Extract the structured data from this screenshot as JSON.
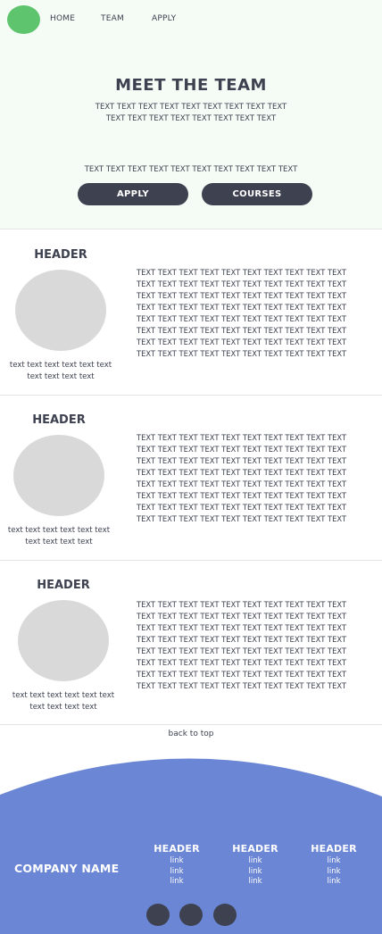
{
  "nav": {
    "home": "HOME",
    "team": "TEAM",
    "apply": "APPLY"
  },
  "hero": {
    "title": "MEET THE TEAM",
    "text": "TEXT TEXT TEXT TEXT TEXT TEXT TEXT TEXT TEXT TEXT TEXT TEXT TEXT TEXT TEXT TEXT TEXT",
    "subtext": "TEXT TEXT TEXT TEXT TEXT TEXT TEXT TEXT TEXT TEXT",
    "apply_button": "APPLY",
    "courses_button": "COURSES"
  },
  "members": [
    {
      "header": "HEADER",
      "caption": "text text text text text text text text text text",
      "body": "TEXT TEXT TEXT TEXT TEXT TEXT TEXT TEXT TEXT TEXT TEXT TEXT TEXT TEXT TEXT TEXT TEXT TEXT TEXT TEXT TEXT TEXT TEXT TEXT TEXT TEXT TEXT TEXT TEXT TEXT TEXT TEXT TEXT TEXT TEXT TEXT TEXT TEXT TEXT TEXT TEXT TEXT TEXT TEXT TEXT TEXT TEXT TEXT TEXT TEXT TEXT TEXT TEXT TEXT TEXT TEXT TEXT TEXT TEXT TEXT TEXT TEXT TEXT TEXT TEXT TEXT TEXT TEXT TEXT TEXT TEXT TEXT TEXT TEXT TEXT TEXT TEXT TEXT TEXT TEXT"
    },
    {
      "header": "HEADER",
      "caption": "text text text text text text text text text text",
      "body": "TEXT TEXT TEXT TEXT TEXT TEXT TEXT TEXT TEXT TEXT TEXT TEXT TEXT TEXT TEXT TEXT TEXT TEXT TEXT TEXT TEXT TEXT TEXT TEXT TEXT TEXT TEXT TEXT TEXT TEXT TEXT TEXT TEXT TEXT TEXT TEXT TEXT TEXT TEXT TEXT TEXT TEXT TEXT TEXT TEXT TEXT TEXT TEXT TEXT TEXT TEXT TEXT TEXT TEXT TEXT TEXT TEXT TEXT TEXT TEXT TEXT TEXT TEXT TEXT TEXT TEXT TEXT TEXT TEXT TEXT TEXT TEXT TEXT TEXT TEXT TEXT TEXT TEXT TEXT TEXT"
    },
    {
      "header": "HEADER",
      "caption": "text text text text text text text text text text",
      "body": "TEXT TEXT TEXT TEXT TEXT TEXT TEXT TEXT TEXT TEXT TEXT TEXT TEXT TEXT TEXT TEXT TEXT TEXT TEXT TEXT TEXT TEXT TEXT TEXT TEXT TEXT TEXT TEXT TEXT TEXT TEXT TEXT TEXT TEXT TEXT TEXT TEXT TEXT TEXT TEXT TEXT TEXT TEXT TEXT TEXT TEXT TEXT TEXT TEXT TEXT TEXT TEXT TEXT TEXT TEXT TEXT TEXT TEXT TEXT TEXT TEXT TEXT TEXT TEXT TEXT TEXT TEXT TEXT TEXT TEXT TEXT TEXT TEXT TEXT TEXT TEXT TEXT TEXT TEXT TEXT"
    }
  ],
  "back_to_top": "back to top",
  "footer": {
    "company": "COMPANY NAME",
    "columns": [
      {
        "header": "HEADER",
        "links": [
          "link",
          "link",
          "link"
        ]
      },
      {
        "header": "HEADER",
        "links": [
          "link",
          "link",
          "link"
        ]
      },
      {
        "header": "HEADER",
        "links": [
          "link",
          "link",
          "link"
        ]
      }
    ],
    "social_icons": [
      "social-icon-1",
      "social-icon-2",
      "social-icon-3"
    ]
  },
  "colors": {
    "hero_bg": "#f5fcf6",
    "logo": "#5ec46d",
    "dark": "#3d4150",
    "footer": "#6b86d4",
    "placeholder": "#d9d9d9"
  }
}
